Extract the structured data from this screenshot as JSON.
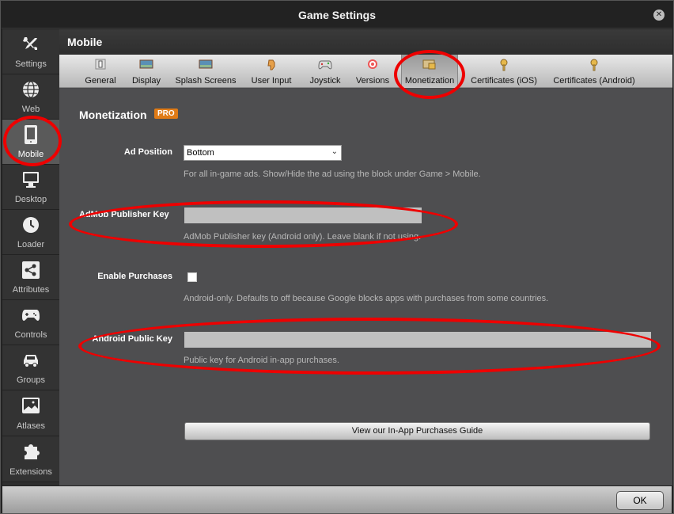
{
  "window": {
    "title": "Game Settings",
    "close_icon": "close-icon"
  },
  "sidebar": {
    "items": [
      {
        "label": "Settings",
        "icon": "wrench-screwdriver-icon"
      },
      {
        "label": "Web",
        "icon": "globe-icon"
      },
      {
        "label": "Mobile",
        "icon": "tablet-icon",
        "active": true
      },
      {
        "label": "Desktop",
        "icon": "monitor-icon"
      },
      {
        "label": "Loader",
        "icon": "clock-icon"
      },
      {
        "label": "Attributes",
        "icon": "share-icon"
      },
      {
        "label": "Controls",
        "icon": "gamepad-icon"
      },
      {
        "label": "Groups",
        "icon": "car-icon"
      },
      {
        "label": "Atlases",
        "icon": "image-icon"
      },
      {
        "label": "Extensions",
        "icon": "puzzle-icon"
      }
    ]
  },
  "main": {
    "heading": "Mobile",
    "tabs": [
      {
        "label": "General",
        "icon": "switch-icon"
      },
      {
        "label": "Display",
        "icon": "landscape-icon"
      },
      {
        "label": "Splash Screens",
        "icon": "landscape-icon"
      },
      {
        "label": "User Input",
        "icon": "pointing-hand-icon"
      },
      {
        "label": "Joystick",
        "icon": "gamepad-icon"
      },
      {
        "label": "Versions",
        "icon": "target-icon"
      },
      {
        "label": "Monetization",
        "icon": "money-icon",
        "active": true
      },
      {
        "label": "Certificates (iOS)",
        "icon": "key-icon"
      },
      {
        "label": "Certificates (Android)",
        "icon": "key-icon"
      }
    ]
  },
  "monetization": {
    "title": "Monetization",
    "badge": "PRO",
    "ad_position": {
      "label": "Ad Position",
      "value": "Bottom",
      "hint": "For all in-game ads. Show/Hide the ad using the block under Game > Mobile."
    },
    "admob_key": {
      "label": "AdMob Publisher Key",
      "value": "",
      "hint": "AdMob Publisher key (Android only). Leave blank if not using."
    },
    "enable_purchases": {
      "label": "Enable Purchases",
      "checked": false,
      "hint": "Android-only. Defaults to off because Google blocks apps with purchases from some countries."
    },
    "android_public_key": {
      "label": "Android Public Key",
      "value": "",
      "hint": "Public key for Android in-app purchases."
    },
    "guide_button": "View our In-App Purchases Guide"
  },
  "footer": {
    "ok_label": "OK"
  },
  "colors": {
    "annotation": "#e00000",
    "pro_badge": "#e07b16"
  }
}
